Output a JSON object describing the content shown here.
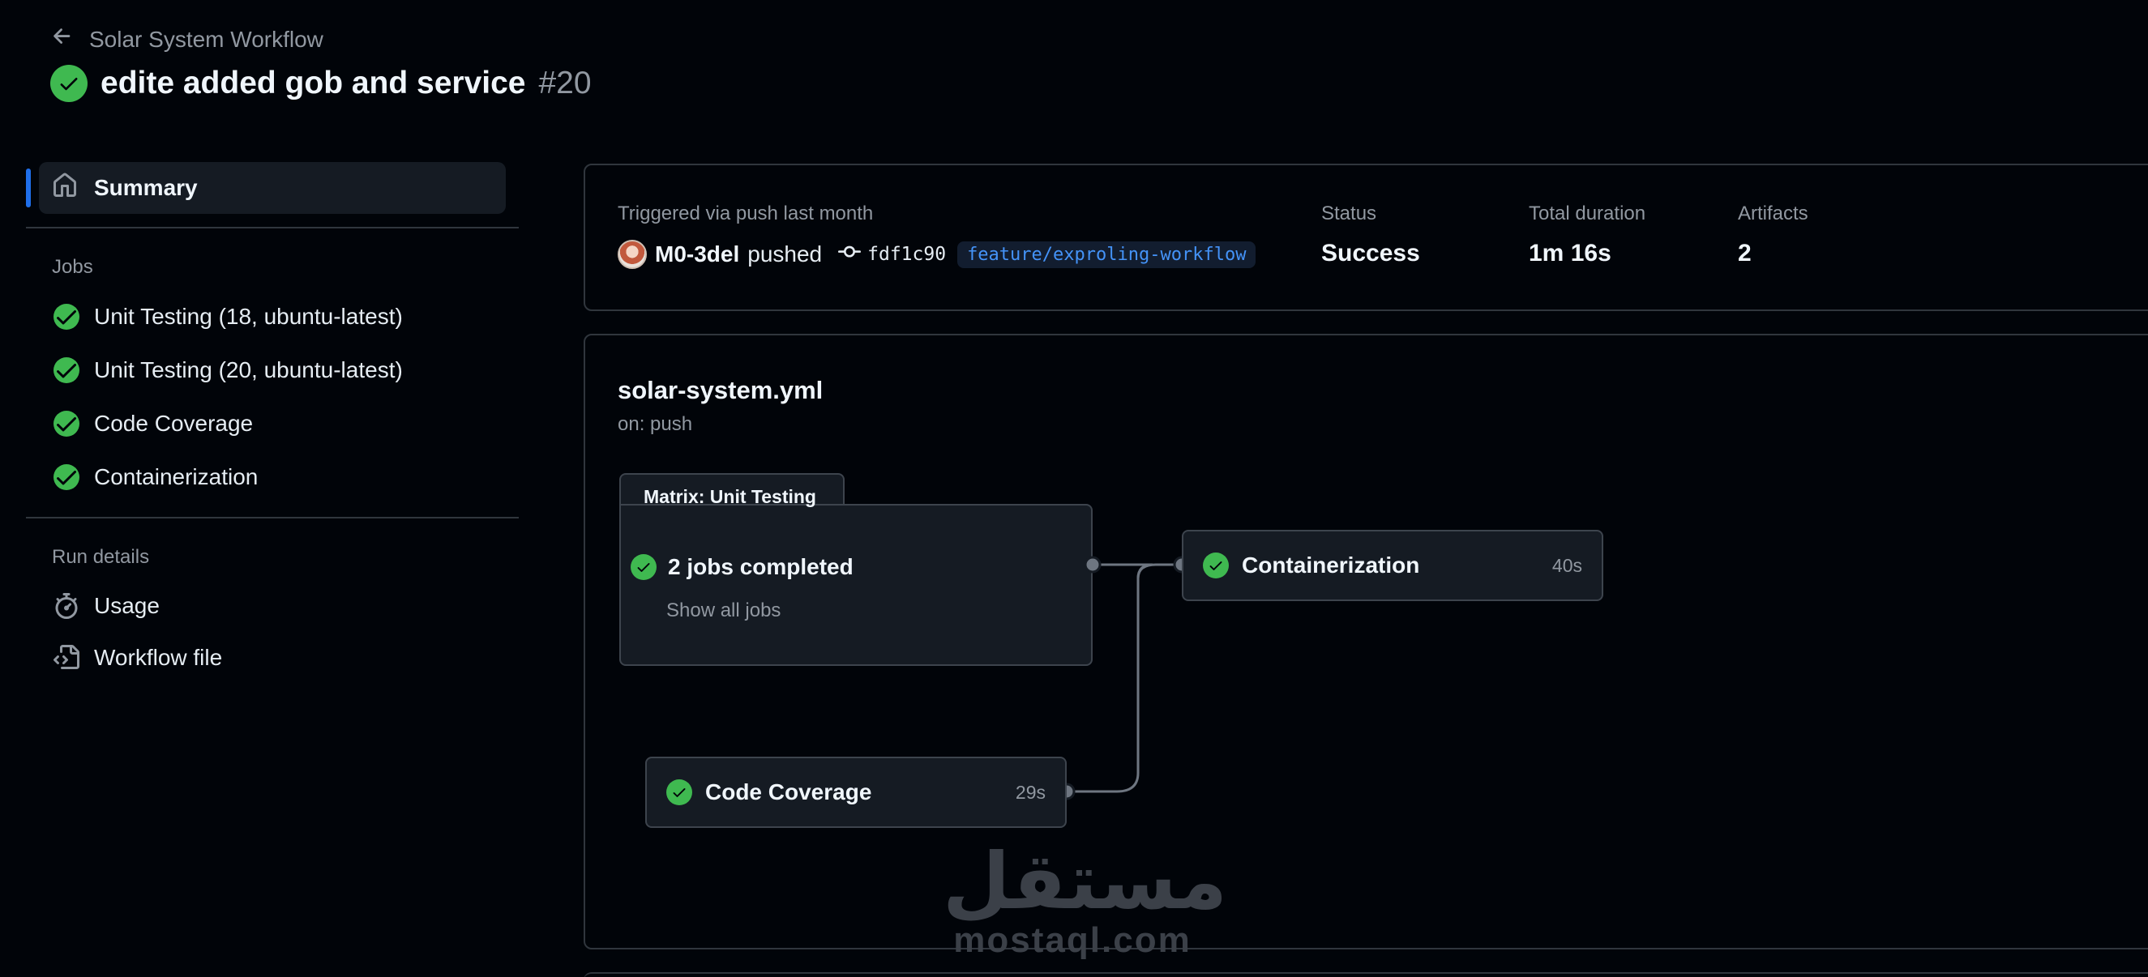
{
  "header": {
    "back_label": "Solar System Workflow",
    "run_title": "edite added gob and service",
    "run_number": "#20"
  },
  "sidebar": {
    "summary_label": "Summary",
    "jobs_heading": "Jobs",
    "jobs": [
      {
        "label": "Unit Testing (18, ubuntu-latest)"
      },
      {
        "label": "Unit Testing (20, ubuntu-latest)"
      },
      {
        "label": "Code Coverage"
      },
      {
        "label": "Containerization"
      }
    ],
    "run_details_heading": "Run details",
    "usage_label": "Usage",
    "workflow_file_label": "Workflow file"
  },
  "summary": {
    "trigger_text": "Triggered via push last month",
    "actor": "M0-3del",
    "action": "pushed",
    "commit": "fdf1c90",
    "branch": "feature/exproling-workflow",
    "status_label": "Status",
    "status_value": "Success",
    "duration_label": "Total duration",
    "duration_value": "1m 16s",
    "artifacts_label": "Artifacts",
    "artifacts_value": "2"
  },
  "workflow": {
    "file_name": "solar-system.yml",
    "trigger": "on: push",
    "matrix_title": "Matrix: Unit Testing",
    "matrix_status": "2 jobs completed",
    "show_all": "Show all jobs",
    "nodes": {
      "containerization": {
        "label": "Containerization",
        "duration": "40s"
      },
      "code_coverage": {
        "label": "Code Coverage",
        "duration": "29s"
      }
    }
  },
  "watermark": {
    "arabic": "مستقل",
    "latin": "mostaql.com"
  },
  "colors": {
    "background": "#010409",
    "success": "#3fb950",
    "accent": "#1f6feb",
    "branch": "#4493f8",
    "border": "#30363d",
    "muted": "#9198a1"
  }
}
